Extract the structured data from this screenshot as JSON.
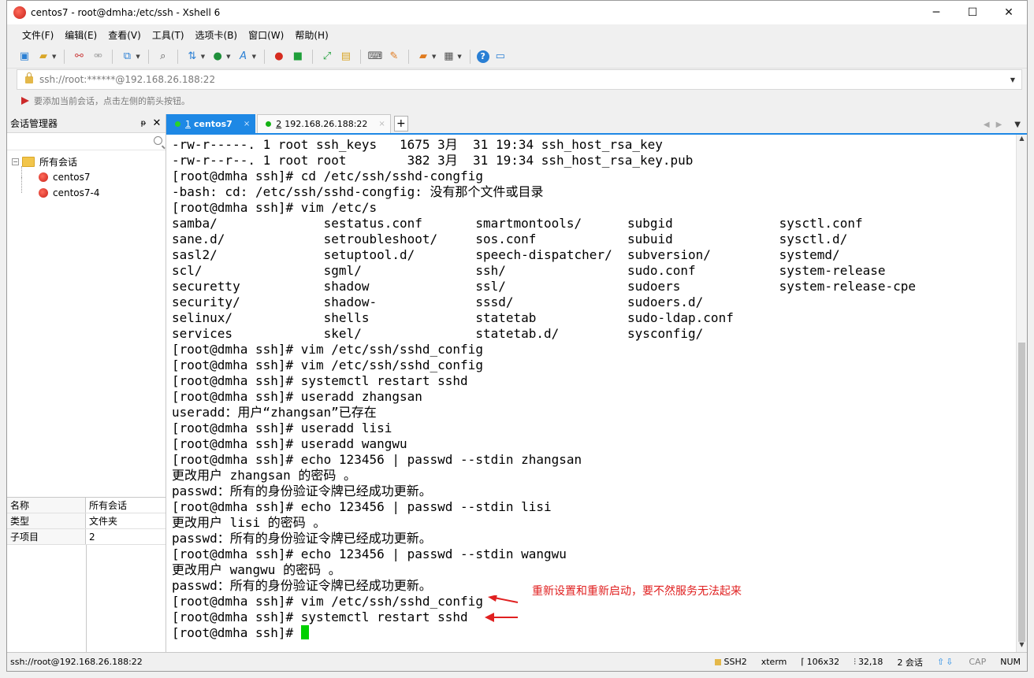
{
  "window": {
    "title": "centos7 - root@dmha:/etc/ssh - Xshell 6",
    "controls": {
      "minimize": "─",
      "maximize": "☐",
      "close": "✕"
    }
  },
  "menu": [
    "文件(F)",
    "编辑(E)",
    "查看(V)",
    "工具(T)",
    "选项卡(B)",
    "窗口(W)",
    "帮助(H)"
  ],
  "toolbar": {
    "icons": [
      "new-session-icon",
      "open-folder-icon",
      "link-icon",
      "unlink-icon",
      "new-window-icon",
      "find-icon",
      "transfer-icon",
      "globe-icon",
      "font-icon",
      "xshell-icon",
      "xftp-icon",
      "fullscreen-icon",
      "lock-icon",
      "keyboard-icon",
      "highlight-icon",
      "new-folder-icon",
      "layout-icon",
      "help-icon",
      "chat-icon"
    ]
  },
  "address": {
    "value": "ssh://root:******@192.168.26.188:22"
  },
  "hint": {
    "text": "要添加当前会话，点击左侧的箭头按钮。"
  },
  "sidebar": {
    "title": "会话管理器",
    "pin": "ᵽ",
    "close": "✕",
    "tree": {
      "root": {
        "label": "所有会话",
        "toggle": "−"
      },
      "items": [
        {
          "label": "centos7"
        },
        {
          "label": "centos7-4"
        }
      ]
    },
    "properties": [
      {
        "key": "名称",
        "value": "所有会话"
      },
      {
        "key": "类型",
        "value": "文件夹"
      },
      {
        "key": "子项目",
        "value": "2"
      }
    ]
  },
  "tabs": [
    {
      "num": "1",
      "label": "centos7",
      "active": true,
      "close": "×"
    },
    {
      "num": "2",
      "label": "192.168.26.188:22",
      "active": false,
      "close": "×"
    }
  ],
  "tab_add": "+",
  "terminal": {
    "lines": [
      "-rw-r-----. 1 root ssh_keys   1675 3月  31 19:34 ssh_host_rsa_key",
      "-rw-r--r--. 1 root root        382 3月  31 19:34 ssh_host_rsa_key.pub",
      "[root@dmha ssh]# cd /etc/ssh/sshd-congfig",
      "-bash: cd: /etc/ssh/sshd-congfig: 没有那个文件或目录",
      "[root@dmha ssh]# vim /etc/s",
      "samba/              sestatus.conf       smartmontools/      subgid              sysctl.conf",
      "sane.d/             setroubleshoot/     sos.conf            subuid              sysctl.d/",
      "sasl2/              setuptool.d/        speech-dispatcher/  subversion/         systemd/",
      "scl/                sgml/               ssh/                sudo.conf           system-release",
      "securetty           shadow              ssl/                sudoers             system-release-cpe",
      "security/           shadow-             sssd/               sudoers.d/",
      "selinux/            shells              statetab            sudo-ldap.conf",
      "services            skel/               statetab.d/         sysconfig/",
      "[root@dmha ssh]# vim /etc/ssh/sshd_config",
      "[root@dmha ssh]# vim /etc/ssh/sshd_config",
      "[root@dmha ssh]# systemctl restart sshd",
      "[root@dmha ssh]# useradd zhangsan",
      "useradd：用户“zhangsan”已存在",
      "[root@dmha ssh]# useradd lisi",
      "[root@dmha ssh]# useradd wangwu",
      "[root@dmha ssh]# echo 123456 | passwd --stdin zhangsan",
      "更改用户 zhangsan 的密码 。",
      "passwd：所有的身份验证令牌已经成功更新。",
      "[root@dmha ssh]# echo 123456 | passwd --stdin lisi",
      "更改用户 lisi 的密码 。",
      "passwd：所有的身份验证令牌已经成功更新。",
      "[root@dmha ssh]# echo 123456 | passwd --stdin wangwu",
      "更改用户 wangwu 的密码 。",
      "passwd：所有的身份验证令牌已经成功更新。",
      "[root@dmha ssh]# vim /etc/ssh/sshd_config",
      "[root@dmha ssh]# systemctl restart sshd"
    ],
    "prompt": "[root@dmha ssh]# ",
    "annotation": "重新设置和重新启动，要不然服务无法起来",
    "annotation_color": "#e02020",
    "cursor_color": "#00d000"
  },
  "status": {
    "left": "ssh://root@192.168.26.188:22",
    "protocol": "SSH2",
    "terminal_type": "xterm",
    "size": "106x32",
    "position": "32,18",
    "sessions": "2 会话",
    "caps": "CAP",
    "num": "NUM"
  },
  "colors": {
    "accent": "#1e88e5",
    "session_green": "#14b214"
  }
}
